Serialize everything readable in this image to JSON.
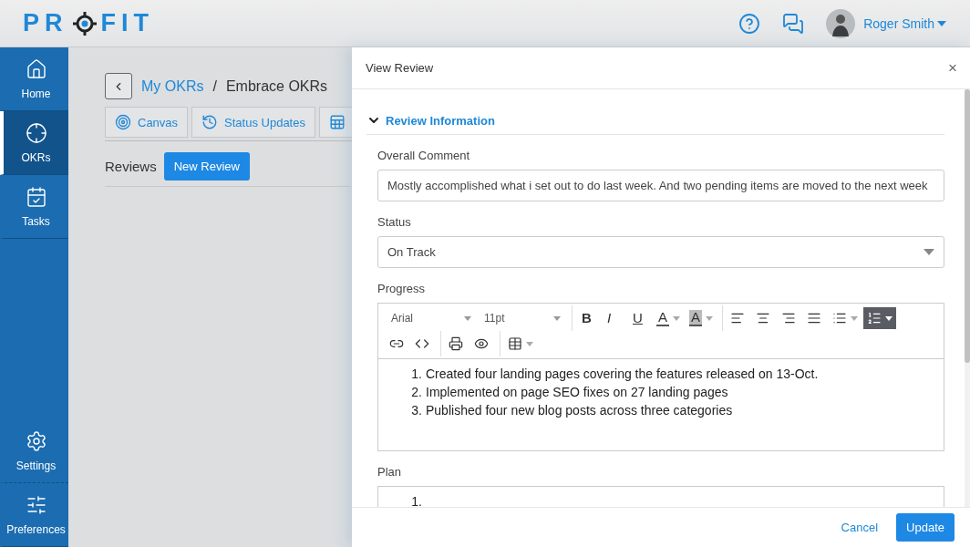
{
  "header": {
    "logo": {
      "before": "PR",
      "after": "FIT"
    },
    "user": "Roger Smith"
  },
  "sidebar": {
    "items": [
      {
        "label": "Home",
        "kind": "home",
        "selected": false
      },
      {
        "label": "OKRs",
        "kind": "target",
        "selected": true
      },
      {
        "label": "Tasks",
        "kind": "tasks",
        "selected": false
      }
    ],
    "bottom_items": [
      {
        "label": "Settings",
        "kind": "settings",
        "selected": false
      },
      {
        "label": "Preferences",
        "kind": "sliders",
        "selected": false
      }
    ]
  },
  "page": {
    "breadcrumb": {
      "link": "My OKRs",
      "separator": "/",
      "current": "Embrace OKRs"
    },
    "tabs": [
      {
        "label": "Canvas",
        "kind": "canvas"
      },
      {
        "label": "Status Updates",
        "kind": "history"
      },
      {
        "kind": "sheet"
      }
    ],
    "section": "Reviews",
    "new_button": "New Review"
  },
  "drawer": {
    "title": "View Review",
    "close": "×",
    "section": {
      "title": "Review Information",
      "expanded": true
    },
    "fields": [
      {
        "kind": "text",
        "label": "Overall Comment",
        "value": "Mostly accomplished what i set out to do last week. And two pending items are moved to the next week"
      },
      {
        "kind": "select",
        "label": "Status",
        "value": "On Track"
      },
      {
        "kind": "editor",
        "label": "Progress",
        "toolbar": {
          "font": "Arial",
          "size": "11pt",
          "rows": [
            [
              [
                {
                  "kind": "bold",
                  "label": "B",
                  "selected": false
                },
                {
                  "kind": "italic",
                  "label": "I",
                  "selected": false
                },
                {
                  "kind": "underline",
                  "label": "U",
                  "selected": false
                },
                {
                  "kind": "forecolor",
                  "label": "A",
                  "dropdown": true,
                  "selected": false
                },
                {
                  "kind": "backcolor",
                  "label": "A",
                  "dropdown": true,
                  "selected": false
                }
              ],
              [
                {
                  "kind": "align-left",
                  "selected": false
                },
                {
                  "kind": "align-center",
                  "selected": false
                },
                {
                  "kind": "align-right",
                  "selected": false
                },
                {
                  "kind": "align-justify",
                  "selected": false
                },
                {
                  "kind": "bullets",
                  "dropdown": true,
                  "selected": false
                },
                {
                  "kind": "numbers",
                  "dropdown": true,
                  "selected": true
                }
              ]
            ],
            [
              [
                {
                  "kind": "link",
                  "selected": false
                },
                {
                  "kind": "code",
                  "selected": false
                }
              ],
              [
                {
                  "kind": "print",
                  "selected": false
                },
                {
                  "kind": "preview",
                  "selected": false
                }
              ],
              [
                {
                  "kind": "table",
                  "dropdown": true,
                  "selected": false
                }
              ]
            ]
          ]
        },
        "items": [
          {
            "number": "1.",
            "text": "Created four landing pages covering the features released on 13-Oct."
          },
          {
            "number": "2.",
            "text": "Implemented on page SEO fixes on 27 landing pages"
          },
          {
            "number": "3.",
            "text": "Published four new blog posts across three categories"
          }
        ]
      },
      {
        "kind": "editor",
        "label": "Plan",
        "items": [
          {
            "number": "1."
          }
        ]
      }
    ]
  },
  "footer": {
    "cancel": "Cancel",
    "update": "Update"
  }
}
